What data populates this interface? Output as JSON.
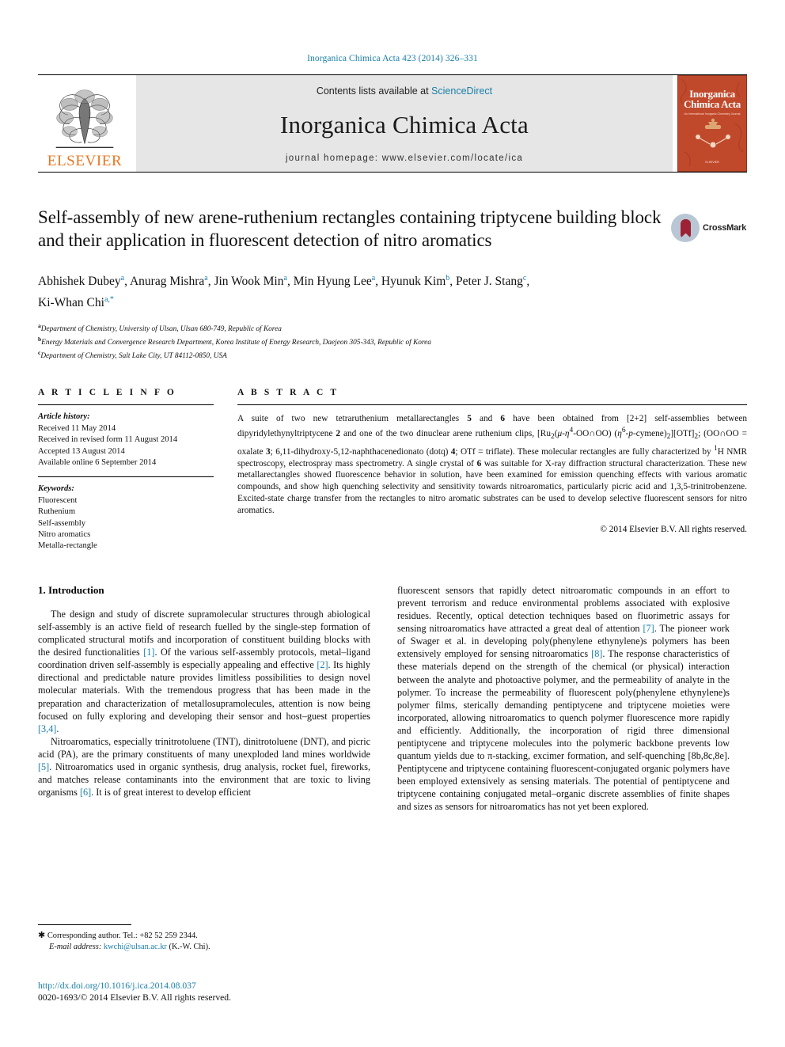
{
  "running_head": "Inorganica Chimica Acta 423 (2014) 326–331",
  "masthead": {
    "contents_prefix": "Contents lists available at ",
    "sciencedirect": "ScienceDirect",
    "journal_title": "Inorganica Chimica Acta",
    "homepage": "journal homepage: www.elsevier.com/locate/ica",
    "publisher": "ELSEVIER",
    "cover": {
      "line1": "Inorganica",
      "line2": "Chimica Acta",
      "subtitle": "An International Inorganic Chemistry Journal",
      "footer": "ELSEVIER"
    },
    "accent_color": "#1a7fa8",
    "elsevier_orange": "#e87722",
    "cover_red": "#c0492c"
  },
  "article": {
    "title": "Self-assembly of new arene-ruthenium rectangles containing triptycene building block and their application in fluorescent detection of nitro aromatics",
    "crossmark_label": "CrossMark",
    "authors_line1": "Abhishek Dubey ᵃ, Anurag Mishra ᵃ, Jin Wook Min ᵃ, Min Hyung Lee ᵃ, Hyunuk Kim ᵇ, Peter J. Stang ᶜ,",
    "authors_line2": "Ki-Whan Chi ᵃ,*",
    "authors": [
      {
        "name": "Abhishek Dubey",
        "sup": "a"
      },
      {
        "name": "Anurag Mishra",
        "sup": "a"
      },
      {
        "name": "Jin Wook Min",
        "sup": "a"
      },
      {
        "name": "Min Hyung Lee",
        "sup": "a"
      },
      {
        "name": "Hyunuk Kim",
        "sup": "b"
      },
      {
        "name": "Peter J. Stang",
        "sup": "c"
      },
      {
        "name": "Ki-Whan Chi",
        "sup": "a,*"
      }
    ],
    "affiliations": [
      {
        "marker": "a",
        "text": "Department of Chemistry, University of Ulsan, Ulsan 680-749, Republic of Korea"
      },
      {
        "marker": "b",
        "text": "Energy Materials and Convergence Research Department, Korea Institute of Energy Research, Daejeon 305-343, Republic of Korea"
      },
      {
        "marker": "c",
        "text": "Department of Chemistry, Salt Lake City, UT 84112-0850, USA"
      }
    ]
  },
  "article_info": {
    "heading": "A R T I C L E   I N F O",
    "history_label": "Article history:",
    "history": [
      "Received 11 May 2014",
      "Received in revised form 11 August 2014",
      "Accepted 13 August 2014",
      "Available online 6 September 2014"
    ],
    "keywords_label": "Keywords:",
    "keywords": [
      "Fluorescent",
      "Ruthenium",
      "Self-assembly",
      "Nitro aromatics",
      "Metalla-rectangle"
    ]
  },
  "abstract": {
    "heading": "A B S T R A C T",
    "text_html": "A suite of two new tetraruthenium metallarectangles <b>5</b> and <b>6</b> have been obtained from [2+2] self-assemblies between dipyridylethynyltriptycene <b>2</b> and one of the two dinuclear arene ruthenium clips, [Ru<sub>2</sub>(<i>&mu;</i>-<i>&eta;</i><sup>4</sup>-OO&#x2229;OO) (<i>&eta;</i><sup>6</sup>-<i>p</i>-cymene)<sub>2</sub>][OTf]<sub>2</sub>; (OO&#x2229;OO = oxalate <b>3</b>; 6,11-dihydroxy-5,12-naphthacenedionato (dotq) <b>4</b>; OTf = triflate). These molecular rectangles are fully characterized by <sup>1</sup>H NMR spectroscopy, electrospray mass spectrometry. A single crystal of <b>6</b> was suitable for X-ray diffraction structural characterization. These new metallarectangles showed fluorescence behavior in solution, have been examined for emission quenching effects with various aromatic compounds, and show high quenching selectivity and sensitivity towards nitroaromatics, particularly picric acid and 1,3,5-trinitrobenzene. Excited-state charge transfer from the rectangles to nitro aromatic substrates can be used to develop selective fluorescent sensors for nitro aromatics.",
    "copyright": "© 2014 Elsevier B.V. All rights reserved."
  },
  "body": {
    "section_heading": "1. Introduction",
    "left_paragraphs_html": [
      "The design and study of discrete supramolecular structures through abiological self-assembly is an active field of research fuelled by the single-step formation of complicated structural motifs and incorporation of constituent building blocks with the desired functionalities <span class=\"ref\">[1]</span>. Of the various self-assembly protocols, metal–ligand coordination driven self-assembly is especially appealing and effective <span class=\"ref\">[2]</span>. Its highly directional and predictable nature provides limitless possibilities to design novel molecular materials. With the tremendous progress that has been made in the preparation and characterization of metallosupramolecules, attention is now being focused on fully exploring and developing their sensor and host–guest properties <span class=\"ref\">[3,4]</span>.",
      "Nitroaromatics, especially trinitrotoluene (TNT), dinitrotoluene (DNT), and picric acid (PA), are the primary constituents of many unexploded land mines worldwide <span class=\"ref\">[5]</span>. Nitroaromatics used in organic synthesis, drug analysis, rocket fuel, fireworks, and matches release contaminants into the environment that are toxic to living organisms <span class=\"ref\">[6]</span>. It is of great interest to develop efficient"
    ],
    "right_paragraphs_html": [
      "fluorescent sensors that rapidly detect nitroaromatic compounds in an effort to prevent terrorism and reduce environmental problems associated with explosive residues. Recently, optical detection techniques based on fluorimetric assays for sensing nitroaromatics have attracted a great deal of attention <span class=\"ref\">[7]</span>. The pioneer work of Swager et al. in developing poly(phenylene ethynylene)s polymers has been extensively employed for sensing nitroaromatics <span class=\"ref\">[8]</span>. The response characteristics of these materials depend on the strength of the chemical (or physical) interaction between the analyte and photoactive polymer, and the permeability of analyte in the polymer. To increase the permeability of fluorescent poly(phenylene ethynylene)s polymer films, sterically demanding pentiptycene and triptycene moieties were incorporated, allowing nitroaromatics to quench polymer fluorescence more rapidly and efficiently. Additionally, the incorporation of rigid three dimensional pentiptycene and triptycene molecules into the polymeric backbone prevents low quantum yields due to &pi;-stacking, excimer formation, and self-quenching [8b,8c,8e]. Pentiptycene and triptycene containing fluorescent-conjugated organic polymers have been employed extensively as sensing materials. The potential of pentiptycene and triptycene containing conjugated metal–organic discrete assemblies of finite shapes and sizes as sensors for nitroaromatics has not yet been explored."
    ]
  },
  "footnote": {
    "corresponding_html": "<span style=\"font-size:11px\">&#10033;</span> Corresponding author. Tel.: +82 52 259 2344.",
    "email_label": "E-mail address:",
    "email": "kwchi@ulsan.ac.kr",
    "email_owner": "(K.-W. Chi)."
  },
  "bottom": {
    "doi": "http://dx.doi.org/10.1016/j.ica.2014.08.037",
    "issn": "0020-1693/© 2014 Elsevier B.V. All rights reserved."
  }
}
